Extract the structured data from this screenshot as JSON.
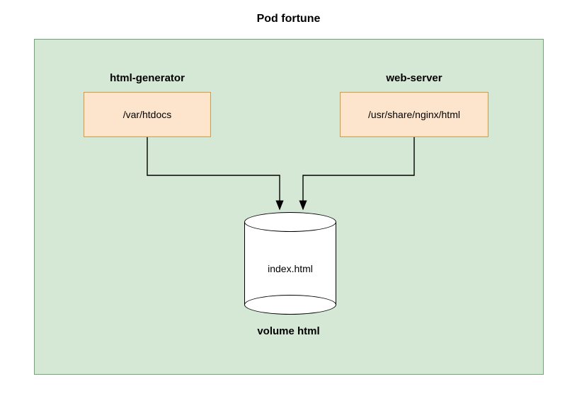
{
  "title": "Pod fortune",
  "containers": {
    "html_generator": {
      "label": "html-generator",
      "mount_path": "/var/htdocs"
    },
    "web_server": {
      "label": "web-server",
      "mount_path": "/usr/share/nginx/html"
    }
  },
  "volume": {
    "label": "volume html",
    "file": "index.html"
  },
  "colors": {
    "pod_bg": "#d5e8d5",
    "pod_border": "#6fa56f",
    "mount_bg": "#fde4cd",
    "mount_border": "#d99a3f"
  }
}
